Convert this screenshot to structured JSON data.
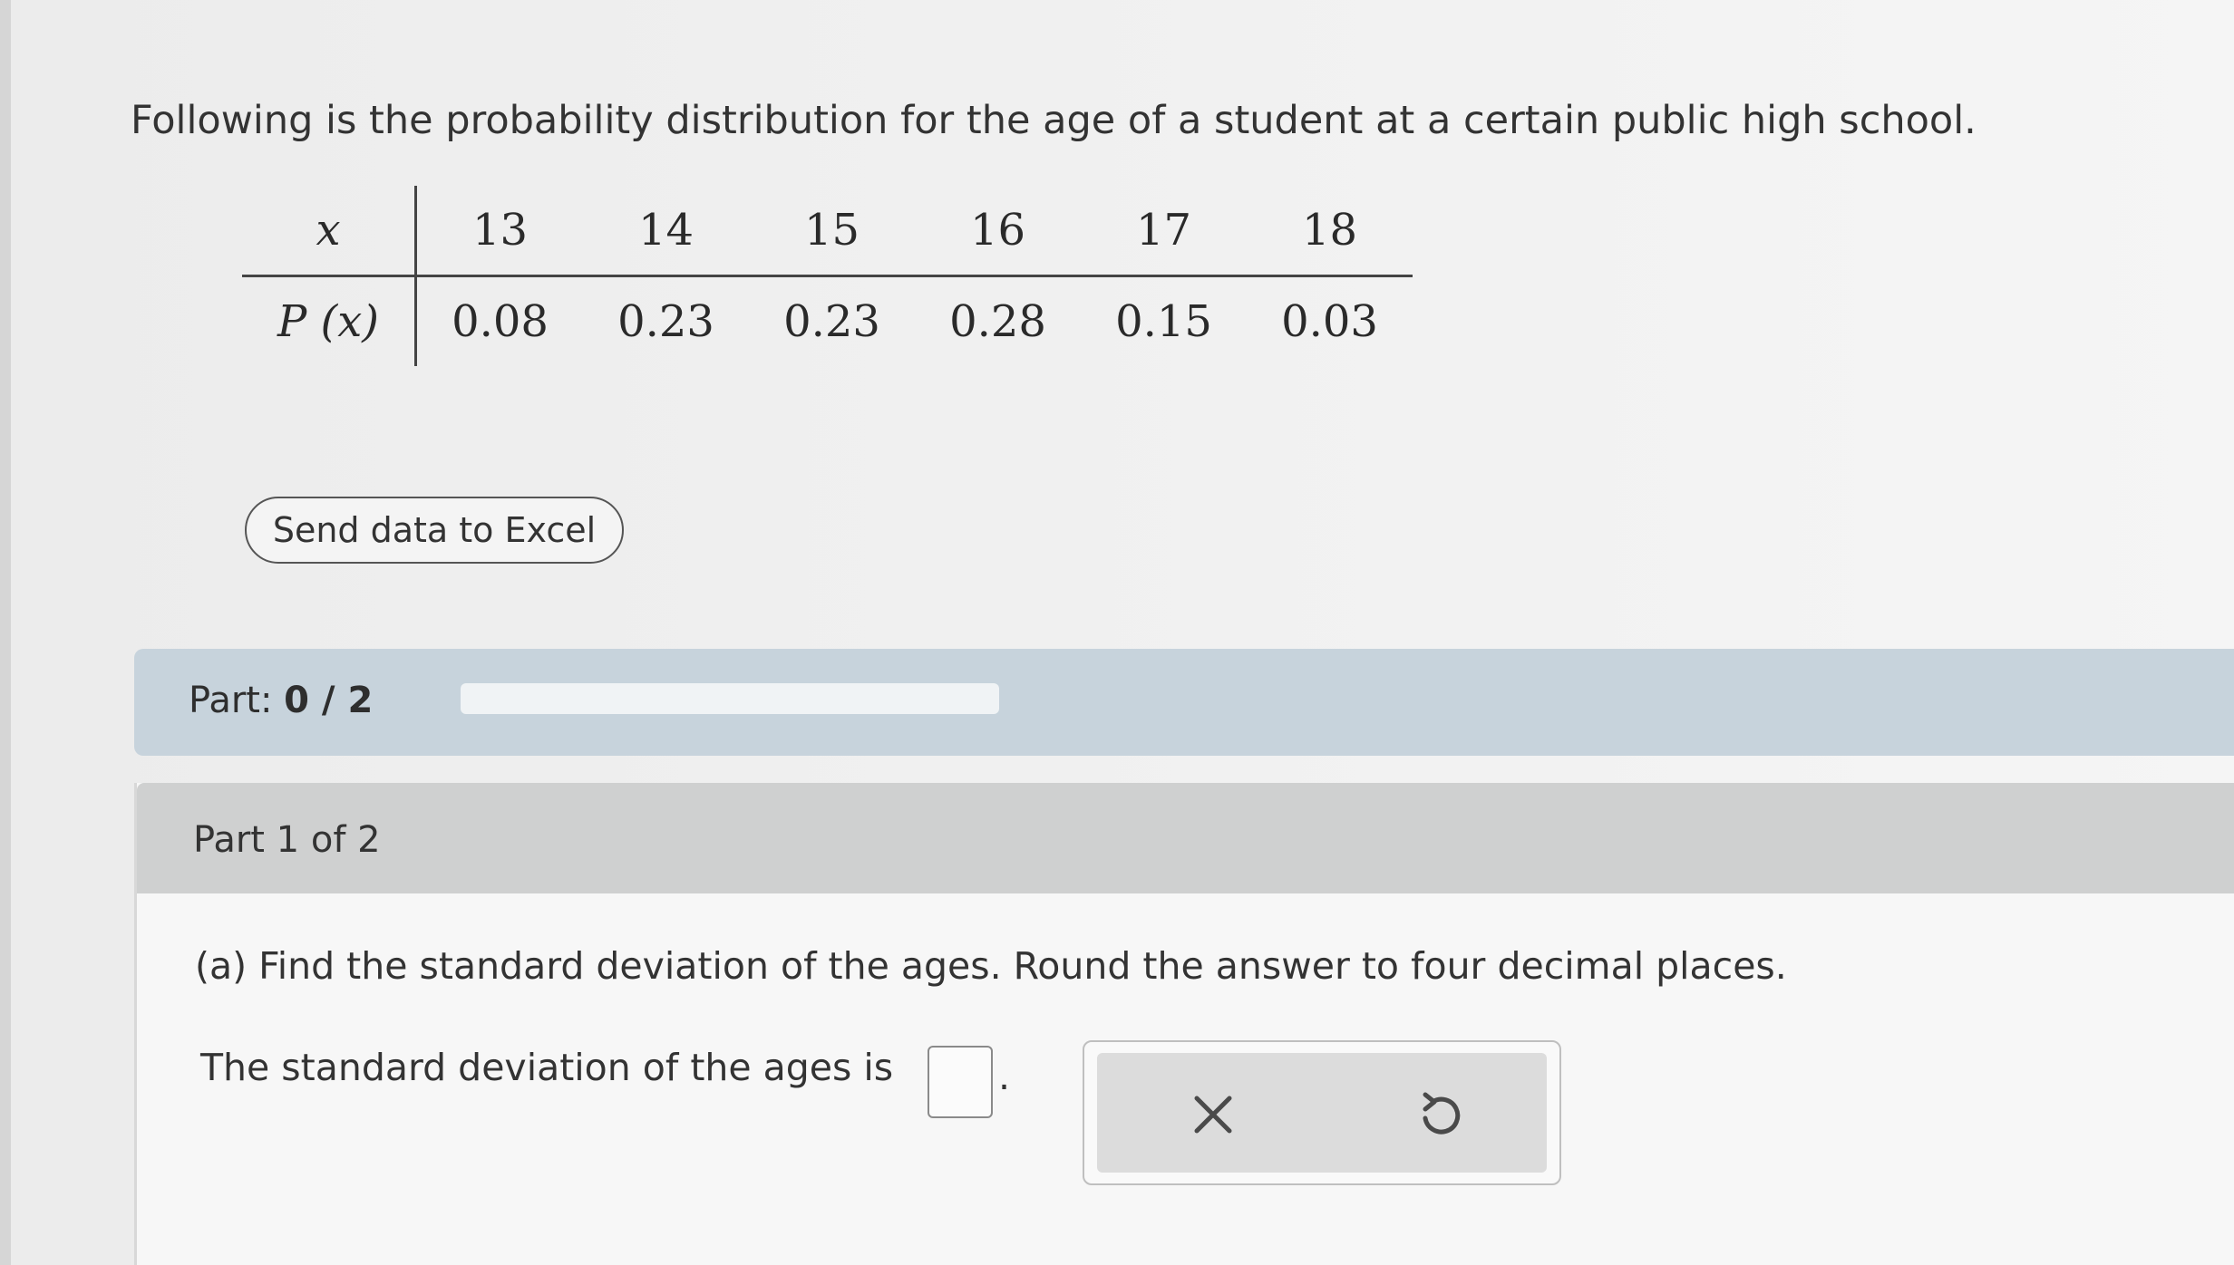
{
  "question": {
    "intro": "Following is the probability distribution for the age of a student at a certain public high school."
  },
  "distribution": {
    "x_label": "x",
    "p_label": "P (x)",
    "x_values": [
      "13",
      "14",
      "15",
      "16",
      "17",
      "18"
    ],
    "p_values": [
      "0.08",
      "0.23",
      "0.23",
      "0.28",
      "0.15",
      "0.03"
    ]
  },
  "excel_button": {
    "label": "Send data to Excel"
  },
  "progress": {
    "prefix": "Part:",
    "value": "0 / 2",
    "fraction": 0
  },
  "part1": {
    "title": "Part 1 of 2",
    "prompt": "(a) Find the standard deviation of the ages. Round the answer to four decimal places.",
    "answer_prefix": "The standard deviation of the ages is",
    "answer_value": "",
    "answer_suffix": "."
  },
  "icons": {
    "clear": "close-icon",
    "undo": "undo-icon"
  }
}
